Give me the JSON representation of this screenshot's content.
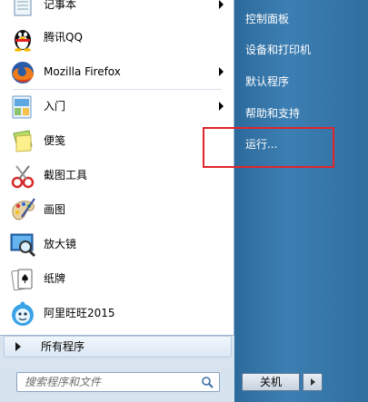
{
  "programs": [
    {
      "label": "记事本",
      "icon": "notepad-icon",
      "has_submenu": true
    },
    {
      "label": "腾讯QQ",
      "icon": "qq-penguin-icon",
      "has_submenu": false
    },
    {
      "label": "Mozilla Firefox",
      "icon": "firefox-icon",
      "has_submenu": true
    },
    {
      "label": "入门",
      "icon": "getting-started-icon",
      "has_submenu": true
    },
    {
      "label": "便笺",
      "icon": "sticky-notes-icon",
      "has_submenu": false
    },
    {
      "label": "截图工具",
      "icon": "snipping-tool-icon",
      "has_submenu": false
    },
    {
      "label": "画图",
      "icon": "paint-icon",
      "has_submenu": false
    },
    {
      "label": "放大镜",
      "icon": "magnifier-icon",
      "has_submenu": false
    },
    {
      "label": "纸牌",
      "icon": "solitaire-icon",
      "has_submenu": false
    },
    {
      "label": "阿里旺旺2015",
      "icon": "aliwangwang-icon",
      "has_submenu": false
    }
  ],
  "all_programs": {
    "label": "所有程序"
  },
  "search": {
    "placeholder": "搜索程序和文件"
  },
  "right_items": [
    {
      "label": "控制面板"
    },
    {
      "label": "设备和打印机"
    },
    {
      "label": "默认程序"
    },
    {
      "label": "帮助和支持"
    },
    {
      "label": "运行..."
    }
  ],
  "shutdown": {
    "label": "关机"
  },
  "colors": {
    "highlight": "#e1252b",
    "right_panel": "#3d7fb3"
  }
}
